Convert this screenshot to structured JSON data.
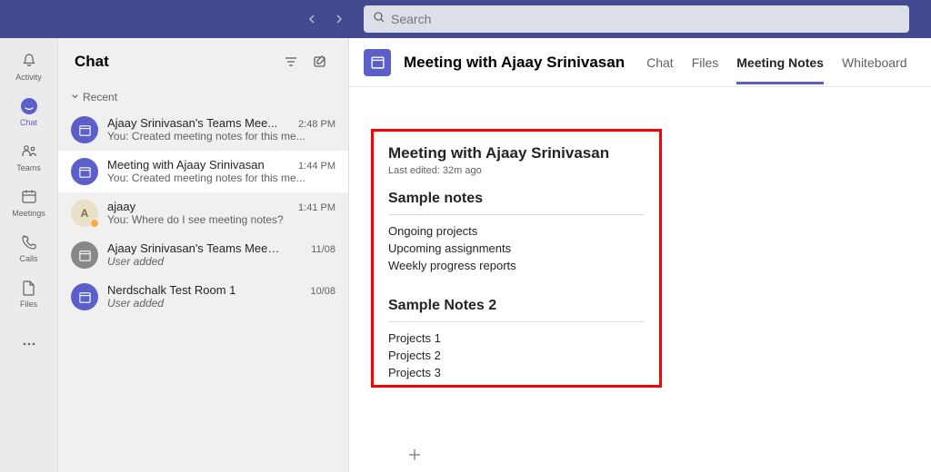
{
  "search": {
    "placeholder": "Search"
  },
  "rail": {
    "items": [
      {
        "label": "Activity"
      },
      {
        "label": "Chat"
      },
      {
        "label": "Teams"
      },
      {
        "label": "Meetings"
      },
      {
        "label": "Calls"
      },
      {
        "label": "Files"
      }
    ]
  },
  "chatPanel": {
    "title": "Chat",
    "recentLabel": "Recent",
    "items": [
      {
        "name": "Ajaay Srinivasan's Teams Mee...",
        "time": "2:48 PM",
        "preview": "You: Created meeting notes for this me..."
      },
      {
        "name": "Meeting with Ajaay Srinivasan",
        "time": "1:44 PM",
        "preview": "You: Created meeting notes for this me..."
      },
      {
        "name": "ajaay",
        "time": "1:41 PM",
        "preview": "You: Where do I see meeting notes?"
      },
      {
        "name": "Ajaay Srinivasan's Teams Meeting",
        "time": "11/08",
        "preview": "User added"
      },
      {
        "name": "Nerdschalk Test Room 1",
        "time": "10/08",
        "preview": "User added"
      }
    ]
  },
  "main": {
    "title": "Meeting with Ajaay Srinivasan",
    "tabs": [
      {
        "label": "Chat"
      },
      {
        "label": "Files"
      },
      {
        "label": "Meeting Notes"
      },
      {
        "label": "Whiteboard"
      }
    ]
  },
  "notes": {
    "title": "Meeting with Ajaay Srinivasan",
    "lastEdited": "Last edited: 32m ago",
    "sections": [
      {
        "heading": "Sample notes",
        "lines": [
          "Ongoing projects",
          "Upcoming assignments",
          "Weekly progress reports"
        ]
      },
      {
        "heading": "Sample Notes 2",
        "lines": [
          "Projects 1",
          "Projects 2",
          "Projects 3"
        ]
      }
    ]
  }
}
